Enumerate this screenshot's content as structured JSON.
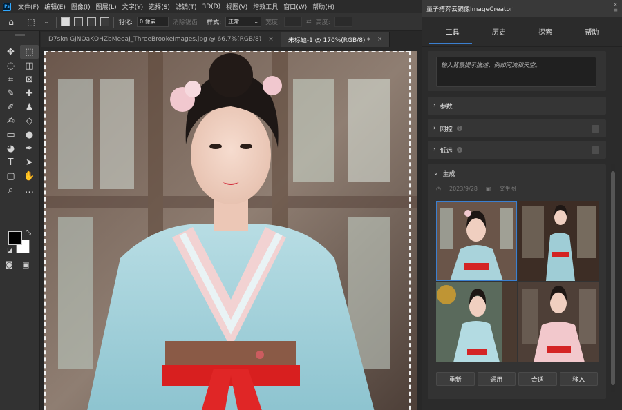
{
  "app": {
    "logo": "Ps"
  },
  "menu": [
    "文件(F)",
    "编辑(E)",
    "图像(I)",
    "图层(L)",
    "文字(Y)",
    "选择(S)",
    "滤镜(T)",
    "3D(D)",
    "视图(V)",
    "增效工具",
    "窗口(W)",
    "帮助(H)"
  ],
  "options": {
    "feather_label": "羽化:",
    "feather_value": "0 像素",
    "antialias_label": "消除锯齿",
    "style_label": "样式:",
    "style_value": "正常",
    "width_label": "宽度:",
    "height_label": "高度:"
  },
  "tabs": [
    {
      "title": "D7skn GJNQaKQHZbMeeaJ_ThreeBrookeImages.jpg @ 66.7%(RGB/8)",
      "close": "×",
      "active": false
    },
    {
      "title": "未标题-1 @ 170%(RGB/8) *",
      "close": "×",
      "active": true
    }
  ],
  "tools": [
    "move-icon",
    "marquee-icon",
    "lasso-icon",
    "object-select-icon",
    "crop-icon",
    "frame-icon",
    "eyedropper-icon",
    "healing-icon",
    "brush-icon",
    "stamp-icon",
    "history-brush-icon",
    "eraser-icon",
    "gradient-icon",
    "blur-icon",
    "dodge-icon",
    "pen-icon",
    "type-icon",
    "path-select-icon",
    "rectangle-icon",
    "hand-icon",
    "zoom-icon",
    "more-icon"
  ],
  "tool_glyphs": [
    "✥",
    "⬚",
    "◌",
    "◫",
    "⌗",
    "⊠",
    "✎",
    "✚",
    "✐",
    "♟",
    "✍",
    "◇",
    "▭",
    "●",
    "◕",
    "✒",
    "T",
    "➤",
    "▢",
    "✋",
    "⌕",
    "…"
  ],
  "colors": {
    "foreground": "#000000",
    "background": "#ffffff",
    "accent": "#3b7fd0"
  },
  "panel": {
    "title": "量子搏弈云镜像ImageCreator",
    "tabs": [
      "工具",
      "历史",
      "探索",
      "帮助"
    ],
    "active_tab": "工具",
    "prompt_placeholder": "输入背景提示描述，例如河流和天空。",
    "sections": [
      {
        "label": "参数",
        "help": false,
        "toggle": false
      },
      {
        "label": "网控",
        "help": true,
        "toggle": true
      },
      {
        "label": "低远",
        "help": true,
        "toggle": true
      },
      {
        "label": "生成",
        "help": false,
        "toggle": false
      }
    ],
    "generation": {
      "date": "2023/9/28",
      "mode": "文生图",
      "selected_index": 0
    },
    "actions": [
      "重新",
      "通用",
      "合适",
      "移入"
    ]
  }
}
